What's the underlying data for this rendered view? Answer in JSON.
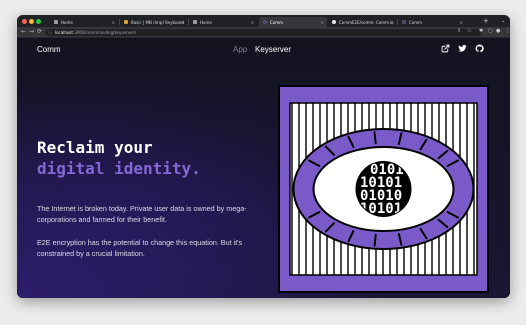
{
  "browser": {
    "tabs": [
      {
        "title": "Home"
      },
      {
        "title": "Basic | MN (Imp) Keyboard"
      },
      {
        "title": "Home"
      },
      {
        "title": "Comm"
      },
      {
        "title": "CommE2E/comm: Comm is"
      },
      {
        "title": "Comm"
      }
    ],
    "new_tab_label": "+",
    "tab_menu_label": "⌄",
    "nav": {
      "back": "←",
      "forward": "→",
      "reload": "⟳",
      "info": "ⓘ"
    },
    "url_host": "localhost",
    "url_path": ":3000/commlanding/keyservers"
  },
  "site": {
    "logo": "Comm",
    "nav_app": "App",
    "nav_keyserver": "Keyserver",
    "headline_line1": "Reclaim your",
    "headline_line2": "digital identity.",
    "paragraph1": "The Internet is broken today. Private user data is owned by mega-corporations and farmed for their benefit.",
    "paragraph2": "E2E encryption has the potential to change this equation. But it's constrained by a crucial limitation.",
    "eye_binary": [
      "0101",
      "10101",
      "01010",
      "10101"
    ]
  },
  "colors": {
    "accent_purple": "#7a5ac9",
    "headline_purple": "#8468d6",
    "background": "#151427"
  },
  "icons": [
    "external-link-icon",
    "twitter-icon",
    "github-icon"
  ]
}
